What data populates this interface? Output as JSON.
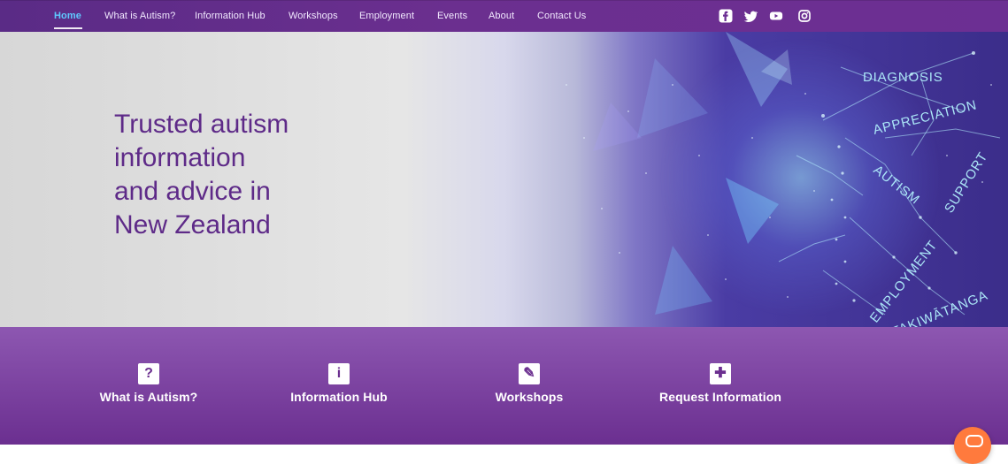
{
  "nav": {
    "items": [
      {
        "label": "Home",
        "active": true
      },
      {
        "label": "What is Autism?",
        "active": false
      },
      {
        "label": "Information Hub",
        "active": false
      },
      {
        "label": "Workshops",
        "active": false
      },
      {
        "label": "Employment",
        "active": false
      },
      {
        "label": "Events",
        "active": false
      },
      {
        "label": "About",
        "active": false
      },
      {
        "label": "Contact Us",
        "active": false
      }
    ],
    "social": [
      "facebook-icon",
      "twitter-icon",
      "youtube-icon",
      "instagram-icon"
    ],
    "colors": {
      "bar": "#6c2f93",
      "active": "#5fc9ff"
    }
  },
  "hero": {
    "title_lines": [
      "Trusted autism",
      "information",
      "and advice in",
      "New Zealand"
    ],
    "overlay_words": [
      "DIAGNOSIS",
      "APPRECIATION",
      "AUTISM",
      "SUPPORT",
      "EMPLOYMENT",
      "TAKIWĀTANGA"
    ],
    "accent": "#5e2a88"
  },
  "features": {
    "items": [
      {
        "label": "What is Autism?",
        "icon": "question-icon"
      },
      {
        "label": "Information Hub",
        "icon": "info-icon"
      },
      {
        "label": "Workshops",
        "icon": "pencil-icon"
      },
      {
        "label": "Request Information",
        "icon": "puzzle-icon"
      }
    ],
    "band_color": "#6b2f90"
  }
}
